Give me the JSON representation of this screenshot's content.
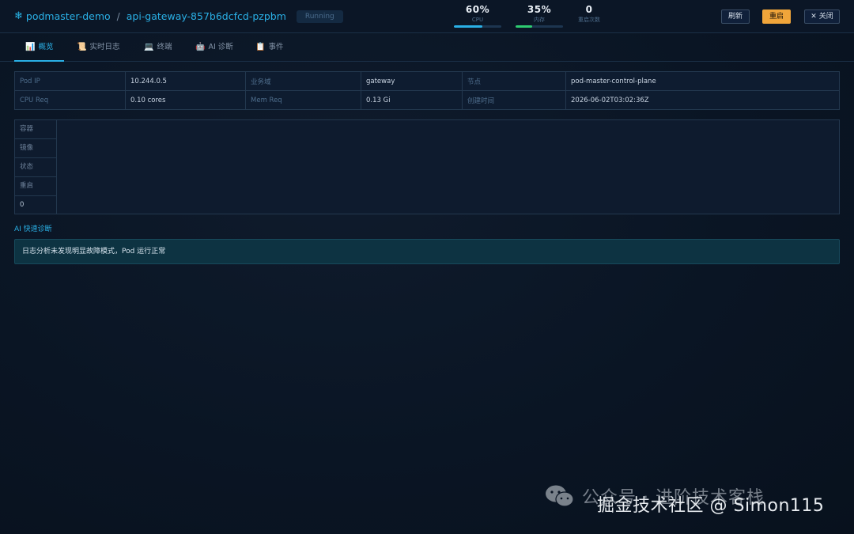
{
  "header": {
    "namespace": "podmaster-demo",
    "separator": "/",
    "pod_name": "api-gateway-857b6dcfcd-pzpbm",
    "status": "Running",
    "stats": [
      {
        "value": "60%",
        "label": "CPU",
        "fill": 0.6,
        "color": "#2ab0e6"
      },
      {
        "value": "35%",
        "label": "内存",
        "fill": 0.35,
        "color": "#2ecc71"
      },
      {
        "value": "0",
        "label": "重启次数"
      }
    ],
    "buttons": {
      "refresh": "刷新",
      "restart": "重启",
      "close": "✕ 关闭"
    }
  },
  "tabs": [
    {
      "icon": "📊",
      "label": "概览",
      "active": true
    },
    {
      "icon": "📜",
      "label": "实时日志"
    },
    {
      "icon": "💻",
      "label": "终端"
    },
    {
      "icon": "🤖",
      "label": "AI 诊断"
    },
    {
      "icon": "📋",
      "label": "事件"
    }
  ],
  "info": {
    "row1": {
      "l1": "Pod IP",
      "v1": "10.244.0.5",
      "l2": "业务域",
      "v2": "gateway",
      "l3": "节点",
      "v3": "pod-master-control-plane"
    },
    "row2": {
      "l1": "CPU Req",
      "v1": "0.10 cores",
      "l2": "Mem Req",
      "v2": "0.13 Gi",
      "l3": "创建时间",
      "v3": "2026-06-02T03:02:36Z"
    }
  },
  "container": {
    "labels": [
      "容器",
      "镜像",
      "状态",
      "重启"
    ],
    "restart_value": "0"
  },
  "ai": {
    "title": "AI 快速诊断",
    "message": "日志分析未发现明显故障模式，Pod 运行正常"
  },
  "watermark": {
    "line1": "公众号 · 进阶技术客栈",
    "line2": "掘金技术社区 @ Simon115"
  },
  "colors": {
    "accent": "#2ab0e6",
    "restart_button": "#f0a53a",
    "ai_box": "#0d3342"
  }
}
